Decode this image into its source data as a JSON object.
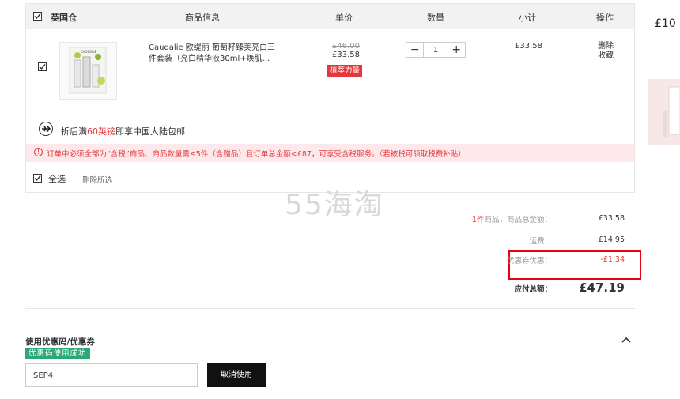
{
  "cart": {
    "warehouse_label": "英国仓",
    "headers": {
      "product": "商品信息",
      "unit_price": "单价",
      "quantity": "数量",
      "subtotal": "小计",
      "action": "操作"
    },
    "item": {
      "title_line1": "Caudalie 欧缇丽 葡萄籽臻美亮白三",
      "title_line2": "件套装（亮白精华液30ml+焕肌...",
      "original_price": "£46.00",
      "price": "£33.58",
      "badge": "植萃力量",
      "quantity": "1",
      "subtotal": "£33.58",
      "delete_label": "删除",
      "favorite_label": "收藏"
    },
    "shipping_promo": {
      "prefix": "折后满",
      "amount": "60英镑",
      "suffix": "即享中国大陆包邮"
    },
    "warning": "订单中必须全部为“含税”商品、商品数量需≤5件（含赠品）且订单总金额<£87，可享受含税服务。（若被税可领取税费补贴）",
    "select_all_label": "全选",
    "delete_selected_label": "删除所选"
  },
  "watermark": "55海淘",
  "summary": {
    "count_text": "1件",
    "goods_total_label": "商品，商品总金额：",
    "goods_total": "£33.58",
    "shipping_label": "运费：",
    "shipping": "£14.95",
    "coupon_label": "优惠券优惠：",
    "coupon": "-£1.34",
    "total_label": "应付总额：",
    "total": "£47.19"
  },
  "coupon_section": {
    "title": "使用优惠码/优惠券",
    "success_badge": "优惠码使用成功",
    "code_value": "SEP4",
    "cancel_button": "取消使用"
  },
  "side_ad": {
    "text": "£10"
  },
  "colors": {
    "accent_red": "#e4393c",
    "success_green": "#2aa876",
    "highlight_border": "#e60012"
  }
}
